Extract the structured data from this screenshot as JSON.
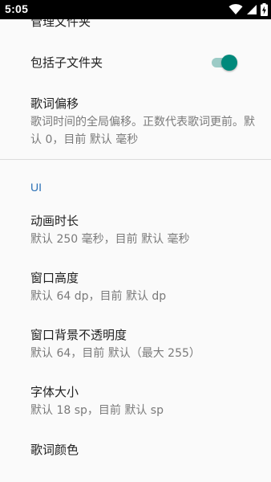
{
  "status_bar": {
    "time": "5:05",
    "icons": [
      "wifi-icon",
      "signal-icon",
      "battery-charging-icon"
    ]
  },
  "settings": {
    "manage_folders": {
      "title": "管理文件夹"
    },
    "include_subfolders": {
      "title": "包括子文件夹",
      "enabled": true
    },
    "lyrics_offset": {
      "title": "歌词偏移",
      "summary": "歌词时间的全局偏移。正数代表歌词更前。默认 0，目前 默认 毫秒"
    },
    "ui_category": "UI",
    "animation_duration": {
      "title": "动画时长",
      "summary": "默认 250 毫秒，目前 默认 毫秒"
    },
    "window_height": {
      "title": "窗口高度",
      "summary": "默认 64 dp，目前 默认 dp"
    },
    "window_bg_opacity": {
      "title": "窗口背景不透明度",
      "summary": "默认 64，目前 默认（最大 255）"
    },
    "font_size": {
      "title": "字体大小",
      "summary": "默认 18 sp，目前 默认 sp"
    },
    "lyrics_color": {
      "title": "歌词颜色"
    }
  },
  "colors": {
    "accent": "#00897b",
    "category": "#2a6fb5"
  }
}
